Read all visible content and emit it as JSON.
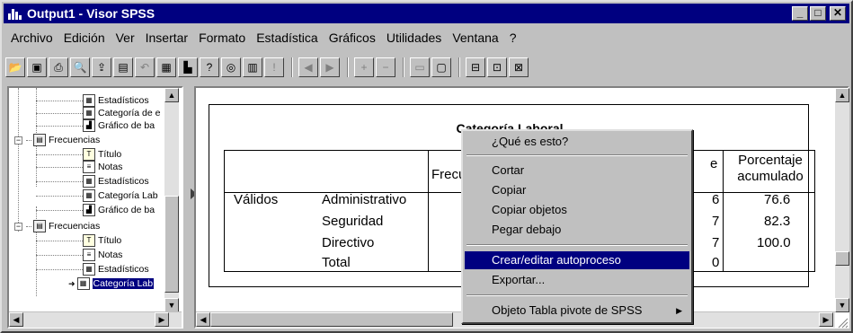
{
  "window": {
    "title": "Output1 - Visor SPSS",
    "buttons": {
      "minimize": "_",
      "maximize": "□",
      "close": "✕"
    }
  },
  "menubar": {
    "items": [
      "Archivo",
      "Edición",
      "Ver",
      "Insertar",
      "Formato",
      "Estadística",
      "Gráficos",
      "Utilidades",
      "Ventana",
      "?"
    ]
  },
  "toolbar": {
    "icons": [
      "open-icon",
      "save-icon",
      "print-icon",
      "print-preview-icon",
      "export-icon",
      "dialog-recall-icon",
      "undo-icon",
      "goto-data-icon",
      "goto-chart-icon",
      "variables-icon",
      "find-icon",
      "case-icon",
      "pivot-icon",
      "designate-window-icon",
      "back-icon",
      "forward-icon",
      "expand-icon",
      "collapse-icon",
      "show-icon",
      "hide-icon",
      "insert-heading-icon",
      "insert-title-icon",
      "insert-text-icon"
    ]
  },
  "tree": {
    "items": [
      {
        "label": "Estadísticos",
        "icon": "output-item-icon"
      },
      {
        "label": "Categoría de e",
        "icon": "output-item-icon"
      },
      {
        "label": "Gráfico de ba",
        "icon": "chart-item-icon"
      },
      {
        "label": "Frecuencias",
        "icon": "folder-icon"
      },
      {
        "label": "Título",
        "icon": "title-item-icon"
      },
      {
        "label": "Notas",
        "icon": "notes-item-icon"
      },
      {
        "label": "Estadísticos",
        "icon": "output-item-icon"
      },
      {
        "label": "Categoría Lab",
        "icon": "output-item-icon"
      },
      {
        "label": "Gráfico de ba",
        "icon": "chart-item-icon"
      },
      {
        "label": "Frecuencias",
        "icon": "folder-icon"
      },
      {
        "label": "Título",
        "icon": "title-item-icon"
      },
      {
        "label": "Notas",
        "icon": "notes-item-icon"
      },
      {
        "label": "Estadísticos",
        "icon": "output-item-icon"
      },
      {
        "label": "Categoría Lab",
        "icon": "output-item-icon",
        "selected": true
      }
    ]
  },
  "pivot": {
    "title": "Categoría Laboral",
    "headers": {
      "frecuencia": "Frecu",
      "porcentaje_valido_tail": "e",
      "porcentaje_acumulado": "Porcentaje acumulado"
    },
    "group_label": "Válidos",
    "rows": [
      {
        "label": "Administrativo",
        "valid_tail": "6",
        "cumulative": "76.6"
      },
      {
        "label": "Seguridad",
        "valid_tail": "7",
        "cumulative": "82.3"
      },
      {
        "label": "Directivo",
        "valid_tail": "7",
        "cumulative": "100.0"
      },
      {
        "label": "Total",
        "valid_tail": "0",
        "cumulative": ""
      }
    ]
  },
  "context_menu": {
    "items": [
      {
        "label": "¿Qué es esto?"
      },
      {
        "label": "Cortar"
      },
      {
        "label": "Copiar"
      },
      {
        "label": "Copiar objetos"
      },
      {
        "label": "Pegar debajo"
      },
      {
        "label": "Crear/editar autoproceso",
        "highlighted": true
      },
      {
        "label": "Exportar..."
      },
      {
        "label": "Objeto Tabla pivote de SPSS",
        "submenu_marker": "▶"
      }
    ]
  },
  "colors": {
    "titlebar": "#000080",
    "face": "#c0c0c0",
    "highlight": "#000080"
  }
}
